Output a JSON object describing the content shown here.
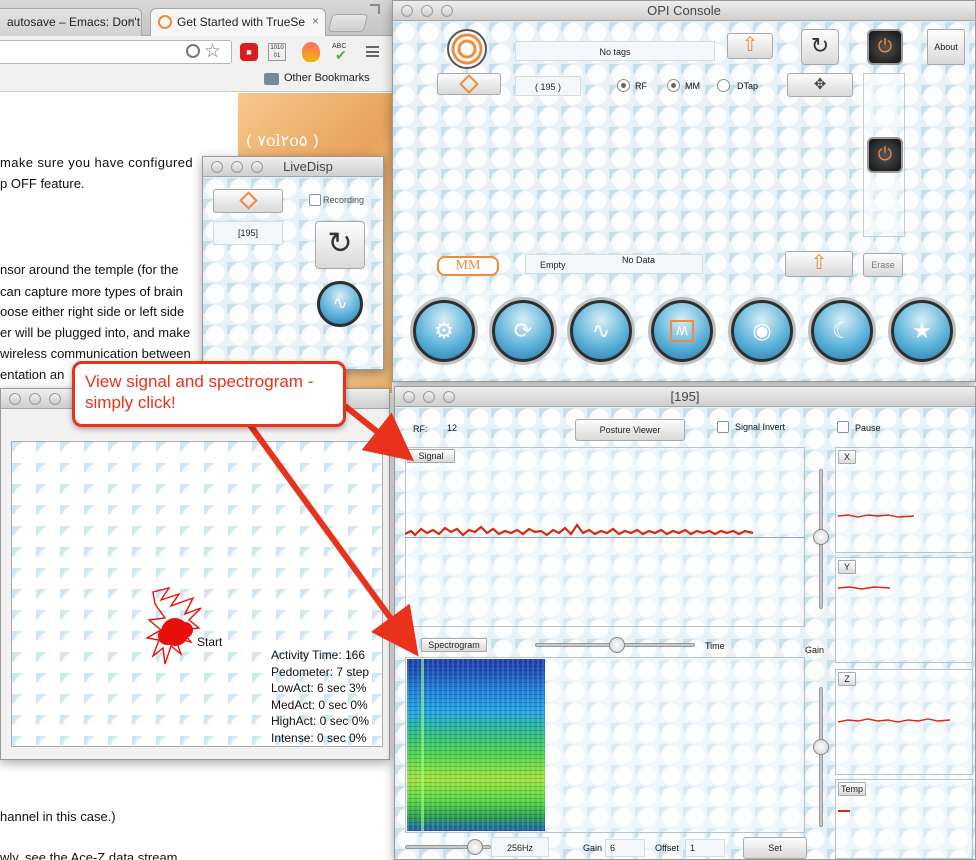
{
  "browser": {
    "tabs": [
      {
        "label": "autosave – Emacs: Don't"
      },
      {
        "label": "Get Started with TrueSe"
      }
    ],
    "bookmark_label": "Other Bookmarks",
    "ext_abc": "ABC",
    "ext_dots": "1010 01"
  },
  "document": {
    "lines": [
      "make sure you have configured",
      "p OFF feature.",
      "nsor around the temple (for the",
      "can capture more types of brain",
      "oose either right side or left side",
      "er will be plugged into, and make",
      "wireless communication between",
      "entation an",
      "hannel in this case.)",
      "wly, see the Ace-Z data stream"
    ],
    "side_image_text": "( ۷ol۲o۵ )"
  },
  "livedisp": {
    "title": "LiveDisp",
    "recording_label": "Recording",
    "id_value": "[195]"
  },
  "opi": {
    "title": "OPI Console",
    "tags_label": "No tags",
    "about_label": "About",
    "count_value": "( 195 )",
    "radio_rf": "RF",
    "radio_mm": "MM",
    "radio_dtap": "DTap",
    "mm_label": "MM",
    "empty_label": "Empty",
    "nodata_label": "No Data",
    "erase_label": "Erase"
  },
  "activity": {
    "start_label": "Start",
    "stats": [
      "Activity Time: 166",
      "Pedometer: 7 step",
      "LowAct:  6 sec 3%",
      "MedAct:  0 sec 0%",
      "HighAct: 0 sec 0%",
      "Intense: 0 sec 0%"
    ]
  },
  "signal_win": {
    "title": "[195]",
    "rf_label": "RF:",
    "rf_value": "12",
    "posture_label": "Posture Viewer",
    "signal_invert_label": "Signal Invert",
    "pause_label": "Pause",
    "signal_label": "Signal",
    "spectrogram_label": "Spectrogram",
    "time_label": "Time",
    "gain_label": "Gain",
    "axis_x": "X",
    "axis_y": "Y",
    "axis_z": "Z",
    "axis_temp": "Temp",
    "hz_label": "256Hz",
    "gain_field_label": "Gain",
    "gain_value": "6",
    "offset_label": "Offset",
    "offset_value": "1",
    "set_label": "Set"
  },
  "callout": {
    "text_line1": "View signal and spectrogram -",
    "text_line2": "simply click!"
  },
  "colors": {
    "accent_red": "#e8321c",
    "signal_red": "#d42a10",
    "orange": "#f08a3c"
  }
}
